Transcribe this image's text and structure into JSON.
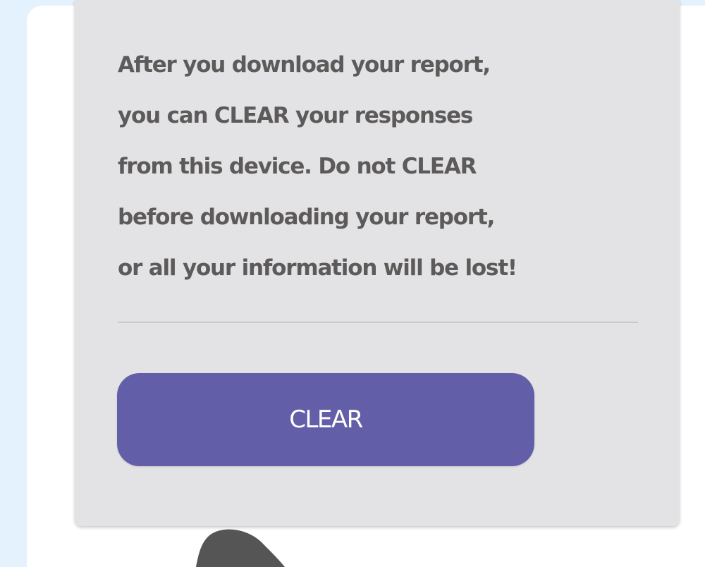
{
  "notice": {
    "lines": [
      "After you download your report,",
      "you can CLEAR your responses",
      "from this device. Do not CLEAR",
      "before downloading your report,",
      "or all your information will be lost!"
    ]
  },
  "clear_button": {
    "label": "CLEAR"
  },
  "colors": {
    "page_background": "#e4f2fd",
    "card_background": "#ffffff",
    "panel_background": "#e3e3e6",
    "notice_text": "#5d5a5a",
    "button_background": "#635ea8",
    "button_text": "#ffffff",
    "cursor": "#555555"
  },
  "icons": {
    "cursor": "hand-pointer-icon"
  }
}
